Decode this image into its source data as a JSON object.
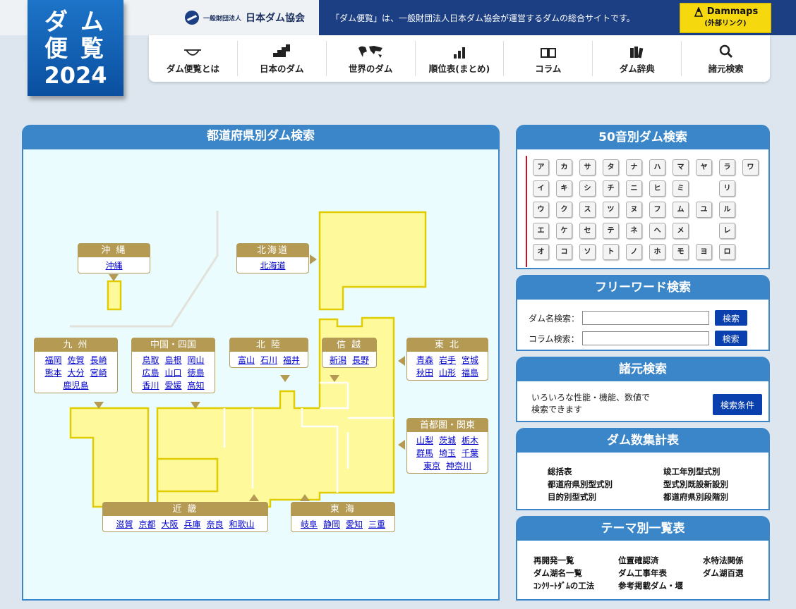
{
  "logo": {
    "line1": "ダム",
    "line2": "便覧",
    "line3": "2024"
  },
  "header": {
    "association_small": "一般財団法人",
    "association_name": "日本ダム協会",
    "tagline": "「ダム便覧」は、一般財団法人日本ダム協会が運営するダムの総合サイトです。",
    "dammaps_label": "Dammaps",
    "dammaps_sub": "(外部リンク)"
  },
  "nav": [
    {
      "label": "ダム便覧とは",
      "icon": "dam-icon"
    },
    {
      "label": "日本のダム",
      "icon": "japan-icon"
    },
    {
      "label": "世界のダム",
      "icon": "world-icon"
    },
    {
      "label": "順位表(まとめ)",
      "icon": "ranking-icon"
    },
    {
      "label": "コラム",
      "icon": "book-icon"
    },
    {
      "label": "ダム辞典",
      "icon": "dictionary-icon"
    },
    {
      "label": "諸元検索",
      "icon": "search-icon"
    }
  ],
  "map_panel": {
    "title": "都道府県別ダム検索",
    "regions": {
      "okinawa": {
        "name": "沖 縄",
        "prefs": [
          "沖縄"
        ]
      },
      "hokkaido": {
        "name": "北海道",
        "prefs": [
          "北海道"
        ]
      },
      "kyushu": {
        "name": "九 州",
        "prefs": [
          "福岡",
          "佐賀",
          "長崎",
          "熊本",
          "大分",
          "宮崎",
          "鹿児島"
        ]
      },
      "chugoku": {
        "name": "中国・四国",
        "prefs": [
          "鳥取",
          "島根",
          "岡山",
          "広島",
          "山口",
          "徳島",
          "香川",
          "愛媛",
          "高知"
        ]
      },
      "hokuriku": {
        "name": "北 陸",
        "prefs": [
          "富山",
          "石川",
          "福井"
        ]
      },
      "shinetsu": {
        "name": "信 越",
        "prefs": [
          "新潟",
          "長野"
        ]
      },
      "tohoku": {
        "name": "東 北",
        "prefs": [
          "青森",
          "岩手",
          "宮城",
          "秋田",
          "山形",
          "福島"
        ]
      },
      "kanto": {
        "name": "首都圏・関東",
        "prefs": [
          "山梨",
          "茨城",
          "栃木",
          "群馬",
          "埼玉",
          "千葉",
          "東京",
          "神奈川"
        ]
      },
      "kinki": {
        "name": "近 畿",
        "prefs": [
          "滋賀",
          "京都",
          "大阪",
          "兵庫",
          "奈良",
          "和歌山"
        ]
      },
      "tokai": {
        "name": "東 海",
        "prefs": [
          "岐阜",
          "静岡",
          "愛知",
          "三重"
        ]
      }
    }
  },
  "kana_panel": {
    "title": "50音別ダム検索",
    "columns": [
      [
        "ア",
        "イ",
        "ウ",
        "エ",
        "オ"
      ],
      [
        "カ",
        "キ",
        "ク",
        "ケ",
        "コ"
      ],
      [
        "サ",
        "シ",
        "ス",
        "セ",
        "ソ"
      ],
      [
        "タ",
        "チ",
        "ツ",
        "テ",
        "ト"
      ],
      [
        "ナ",
        "ニ",
        "ヌ",
        "ネ",
        "ノ"
      ],
      [
        "ハ",
        "ヒ",
        "フ",
        "ヘ",
        "ホ"
      ],
      [
        "マ",
        "ミ",
        "ム",
        "メ",
        "モ"
      ],
      [
        "ヤ",
        "",
        "ユ",
        "",
        "ヨ"
      ],
      [
        "ラ",
        "リ",
        "ル",
        "レ",
        "ロ"
      ],
      [
        "ワ",
        "",
        "",
        "",
        ""
      ]
    ]
  },
  "free_panel": {
    "title": "フリーワード検索",
    "dam_label": "ダム名検索：",
    "column_label": "コラム検索：",
    "button": "検索"
  },
  "spec_panel": {
    "title": "諸元検索",
    "text1": "いろいろな性能・機能、数値で",
    "text2": "検索できます",
    "button": "検索条件"
  },
  "count_panel": {
    "title": "ダム数集計表",
    "left": [
      "総括表",
      "都道府県別型式別",
      "目的別型式別"
    ],
    "right": [
      "竣工年別型式別",
      "型式別既設新設別",
      "都道府県別段階別"
    ]
  },
  "theme_panel": {
    "title": "テーマ別一覧表",
    "col1": [
      "再開発一覧",
      "ダム湖名一覧",
      "ｺﾝｸﾘｰﾄﾀﾞﾑの工法"
    ],
    "col2": [
      "位置確認済",
      "ダム工事年表",
      "参考掲載ダム・堰"
    ],
    "col3": [
      "水特法関係",
      "ダム湖百選"
    ]
  },
  "colors": {
    "brand": "#1b3f82",
    "panel": "#3a86c8",
    "region": "#b49a52",
    "land": "#fef99a",
    "button": "#0a3fae",
    "dammaps": "#f5d80e"
  }
}
